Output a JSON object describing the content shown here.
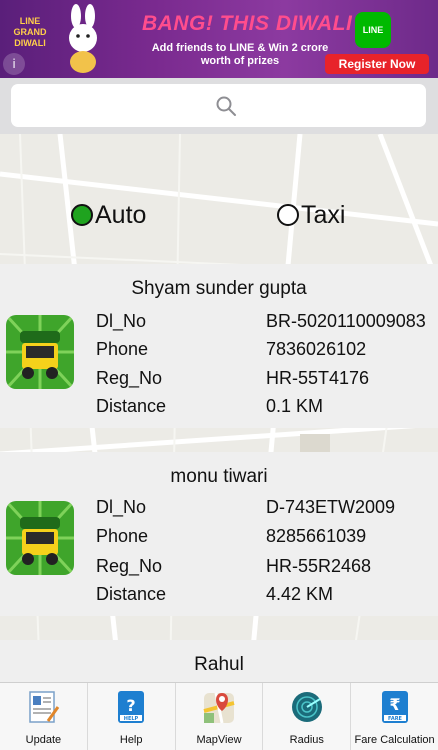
{
  "banner": {
    "brand_text": "LINE GRAND DIWALI",
    "headline": "BANG! THIS DIWALI",
    "subtext": "Add friends to LINE & Win 2 crore worth of prizes",
    "line_logo": "LINE",
    "register_label": "Register Now",
    "info_label": "i"
  },
  "search": {
    "icon": "search-icon"
  },
  "vehicle_options": [
    {
      "label": "Auto",
      "selected": true
    },
    {
      "label": "Taxi",
      "selected": false
    }
  ],
  "field_labels": {
    "dl": "Dl_No",
    "phone": "Phone",
    "reg": "Reg_No",
    "distance": "Distance"
  },
  "drivers": [
    {
      "name": "Shyam sunder gupta",
      "dl_no": "BR-5020110009083",
      "phone": "7836026102",
      "reg_no": "HR-55T4176",
      "distance": "0.1 KM"
    },
    {
      "name": "monu tiwari",
      "dl_no": "D-743ETW2009",
      "phone": "8285661039",
      "reg_no": "HR-55R2468",
      "distance": "4.42 KM"
    },
    {
      "name": "Rahul"
    }
  ],
  "tabs": [
    {
      "label": "Update",
      "icon": "update-icon"
    },
    {
      "label": "Help",
      "icon": "help-icon",
      "badge": "HELP"
    },
    {
      "label": "MapView",
      "icon": "mapview-icon"
    },
    {
      "label": "Radius",
      "icon": "radius-icon"
    },
    {
      "label": "Fare Calculation",
      "icon": "fare-icon",
      "badge": "FARE"
    }
  ],
  "colors": {
    "auto_selected": "#1fa31f",
    "banner_bg": "#6e2a8a",
    "register_button": "#e8232a",
    "line_green": "#00b900"
  }
}
